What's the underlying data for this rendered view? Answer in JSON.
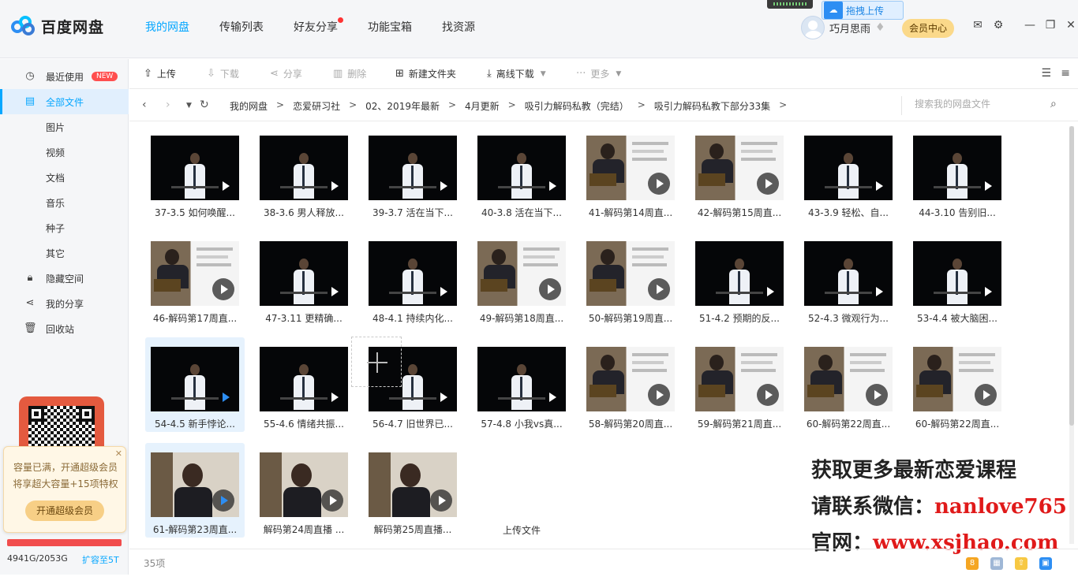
{
  "app": {
    "name": "百度网盘",
    "nav": [
      {
        "label": "我的网盘",
        "active": true
      },
      {
        "label": "传输列表"
      },
      {
        "label": "好友分享",
        "dot": true
      },
      {
        "label": "功能宝箱"
      },
      {
        "label": "找资源"
      }
    ],
    "drag_upload_label": "拖拽上传",
    "username": "巧月思雨",
    "vip_label": "会员中心"
  },
  "sidebar": {
    "recent": "最近使用",
    "new_badge": "NEW",
    "all_files": "全部文件",
    "sub": [
      "图片",
      "视频",
      "文档",
      "音乐",
      "种子",
      "其它"
    ],
    "hidden": "隐藏空间",
    "share": "我的分享",
    "trash": "回收站",
    "notice_line1": "容量已满，开通超级会员",
    "notice_line2": "将享超大容量+15项特权",
    "notice_btn": "开通超级会员",
    "quota_used_fraction": 1.0,
    "quota": "4941G/2053G",
    "expand": "扩容至5T"
  },
  "toolbar": {
    "upload": "上传",
    "download": "下载",
    "share": "分享",
    "delete": "删除",
    "new_folder": "新建文件夹",
    "offline": "离线下载",
    "more": "更多"
  },
  "breadcrumb": [
    "我的网盘",
    "恋爱研习社",
    "02、2019年最新",
    "4月更新",
    "吸引力解码私教（完结）",
    "吸引力解码私教下部分33集"
  ],
  "search": {
    "placeholder": "搜索我的网盘文件"
  },
  "files": [
    "37-3.5 如何唤醒...",
    "38-3.6 男人释放...",
    "39-3.7 活在当下...",
    "40-3.8 活在当下...",
    "41-解码第14周直...",
    "42-解码第15周直...",
    "43-3.9 轻松、自...",
    "44-3.10 告别旧...",
    "46-解码第17周直...",
    "47-3.11 更精确...",
    "48-4.1 持续内化...",
    "49-解码第18周直...",
    "50-解码第19周直...",
    "51-4.2 预期的反...",
    "52-4.3 微观行为...",
    "53-4.4 被大脑困...",
    "54-4.5 新手悖论...",
    "55-4.6 情绪共振...",
    "56-4.7 旧世界已...",
    "57-4.8 小我vs真...",
    "58-解码第20周直...",
    "59-解码第21周直...",
    "60-解码第22周直...",
    "60-解码第22周直...",
    "61-解码第23周直...",
    "解码第24周直播 ...",
    "解码第25周直播..."
  ],
  "upload_tile": "上传文件",
  "ad": {
    "line1": "获取更多最新恋爱课程",
    "line2_prefix": "请联系微信：",
    "line2_value": "nanlove765",
    "line3_prefix": "官网：",
    "line3_value": "www.xsjhao.com"
  },
  "status": {
    "count": "35项"
  },
  "colors": {
    "accent": "#06a7ff",
    "quota_bar": "#f14d4d",
    "vip": "#fbd98a"
  }
}
